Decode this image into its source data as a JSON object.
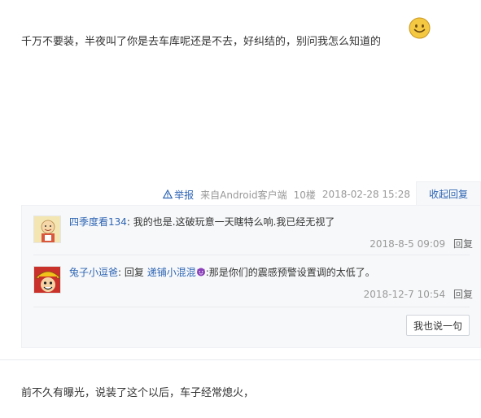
{
  "post1": {
    "text": "千万不要装，半夜叫了你是去车库呢还是不去，好纠结的，别问我怎么知道的",
    "emoji_icon": "smiley-emoji-icon"
  },
  "tail": {
    "report_label": "举报",
    "client": "来自Android客户端",
    "floor": "10楼",
    "datetime": "2018-02-28 15:28",
    "collapse_label": "收起回复"
  },
  "replies": [
    {
      "user": "四季度看134",
      "text": "我的也是.这破玩意一天瞎特么响.我已经无视了",
      "datetime": "2018-8-5 09:09",
      "reply_label": "回复"
    },
    {
      "user": "兔子小逗爸",
      "prefix": "回复 ",
      "mention": "递铺小混混",
      "text": ":那是你们的震感预警设置调的太低了。",
      "datetime": "2018-12-7 10:54",
      "reply_label": "回复"
    }
  ],
  "say_button": "我也说一句",
  "post2": {
    "text": "前不久有曝光，说装了这个以后，车子经常熄火，"
  },
  "colors": {
    "link": "#2d64b3",
    "muted": "#999999",
    "reply_bg": "#f7f8fa"
  }
}
